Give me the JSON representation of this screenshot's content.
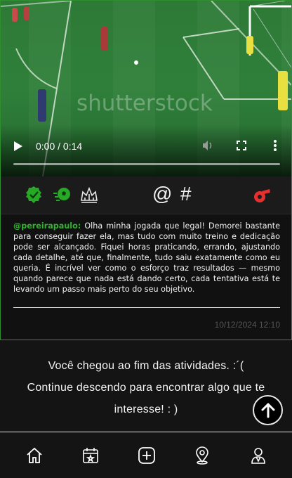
{
  "video": {
    "watermark": "shutterstock",
    "time_display": "0:00 / 0:14",
    "controls": {
      "play_icon": "play-icon",
      "volume_icon": "volume-icon",
      "fullscreen_icon": "fullscreen-icon",
      "more_icon": "more-vertical-icon"
    }
  },
  "actions": {
    "left": [
      "award-badge-icon",
      "soccer-ball-icon",
      "crown-icon"
    ],
    "mention_symbol": "@",
    "hashtag_symbol": "#",
    "report_icon": "whistle-icon"
  },
  "colors": {
    "accent_green": "#2fb52f",
    "alert_red": "#e53030",
    "border_green": "#2f8f2f"
  },
  "post": {
    "username": "@pereirapaulo:",
    "text": "Olha minha jogada que legal! Demorei bastante para conseguir fazer ela, mas tudo com muito treino e dedicação pode ser alcançado. Fiquei horas praticando, errando, ajustando cada detalhe, até que, finalmente, tudo saiu exatamente como eu queria. É incrível ver como o esforço traz resultados — mesmo quando parece que nada está dando certo, cada tentativa está te levando um passo mais perto do seu objetivo.",
    "timestamp": "10/12/2024 12:10"
  },
  "feed_end": {
    "line1": "Você chegou ao fim das atividades. :´(",
    "line2": "Continue descendo para encontrar algo que te",
    "line3": "interesse! : )",
    "scroll_top_icon": "arrow-up-icon"
  },
  "bottom_nav": {
    "items": [
      "home-icon",
      "calendar-icon",
      "add-icon",
      "location-icon",
      "profile-icon"
    ]
  }
}
